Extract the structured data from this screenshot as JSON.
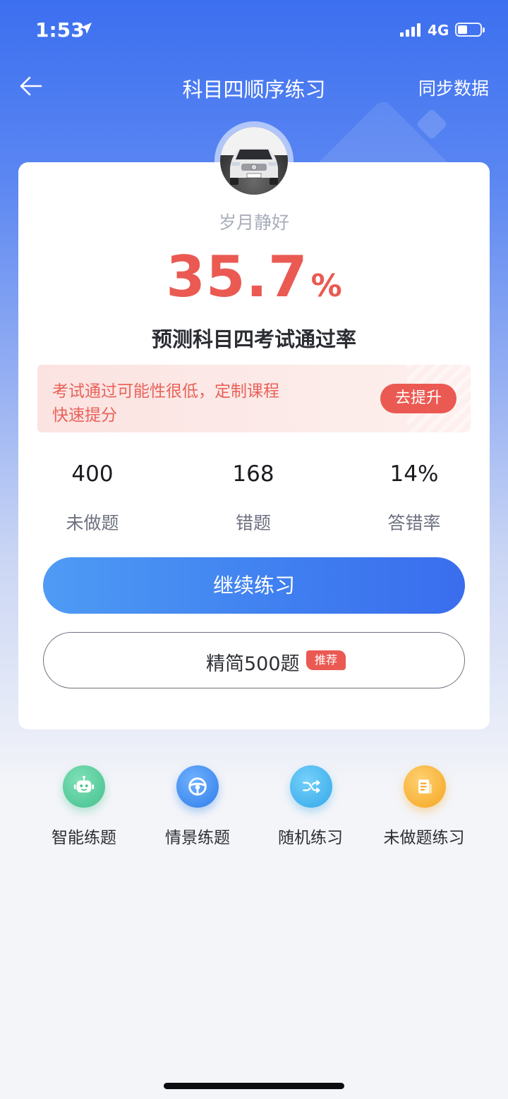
{
  "status_bar": {
    "time": "1:53",
    "network": "4G"
  },
  "nav": {
    "title": "科目四顺序练习",
    "sync_label": "同步数据"
  },
  "profile": {
    "username": "岁月静好"
  },
  "pass_rate": {
    "value": "35.7",
    "unit": "%",
    "label": "预测科目四考试通过率",
    "progress": 0.357
  },
  "promo": {
    "line1": "考试通过可能性很低，定制课程",
    "line2": "快速提分",
    "button_label": "去提升"
  },
  "stats": [
    {
      "value": "400",
      "label": "未做题"
    },
    {
      "value": "168",
      "label": "错题"
    },
    {
      "value": "14%",
      "label": "答错率"
    }
  ],
  "actions": {
    "continue_label": "继续练习",
    "simplified_label": "精简500题",
    "recommend_badge": "推荐"
  },
  "quick_actions": [
    {
      "label": "智能练题",
      "icon": "robot-icon",
      "color": "#55cfa0"
    },
    {
      "label": "情景练题",
      "icon": "steering-wheel-icon",
      "color": "#3b8cf3"
    },
    {
      "label": "随机练习",
      "icon": "shuffle-icon",
      "color": "#3fb0ec"
    },
    {
      "label": "未做题练习",
      "icon": "document-icon",
      "color": "#f7b02e"
    }
  ],
  "colors": {
    "accent": "#3f7ef0",
    "danger": "#ea5a52"
  }
}
